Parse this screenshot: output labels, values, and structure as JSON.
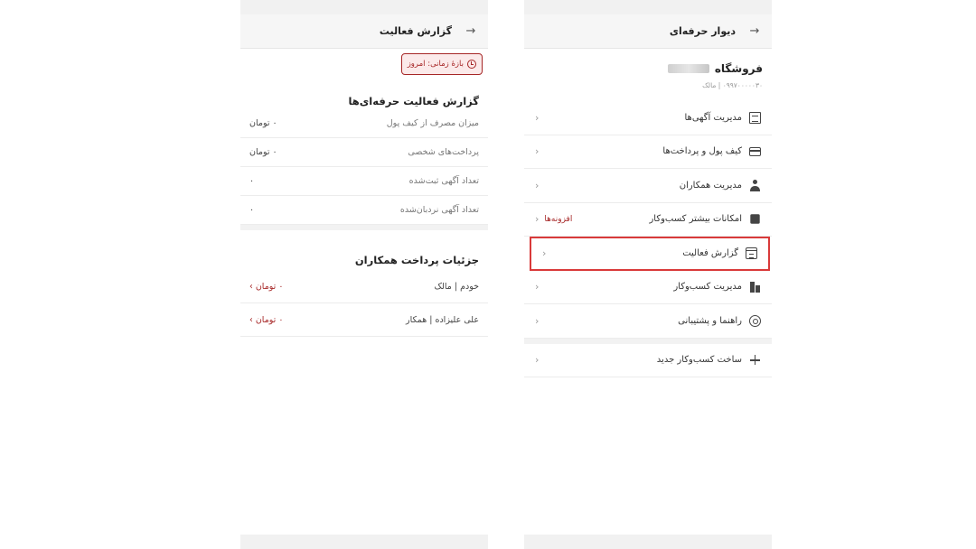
{
  "report": {
    "header": {
      "back_icon": "arrow-right-icon",
      "title": "گزارش فعالیت"
    },
    "period_chip": {
      "label": "بازهٔ زمانی: امروز",
      "color": "#a62626"
    },
    "pro_section": {
      "title": "گزارش فعالیت حرفه‌ای‌ها",
      "rows": [
        {
          "label": "میزان مصرف از کیف پول",
          "value": "۰ تومان"
        },
        {
          "label": "پرداخت‌های شخصی",
          "value": "۰ تومان"
        },
        {
          "label": "تعداد آگهی ثبت‌شده",
          "value": "۰"
        },
        {
          "label": "تعداد آگهی نردبان‌شده",
          "value": "۰"
        }
      ]
    },
    "colleague_section": {
      "title": "جزئیات پرداخت همکاران",
      "rows": [
        {
          "label": "خودم | مالک",
          "value": "۰ تومان ›"
        },
        {
          "label": "علی علیزاده | همکار",
          "value": "۰ تومان ›"
        }
      ]
    }
  },
  "menu": {
    "header": {
      "back_icon": "arrow-right-icon",
      "title": "دیوار حرفه‌ای"
    },
    "shop": {
      "name": "فروشگاه",
      "meta": "۰۹۹۷۰۰۰۰۰۳۰ | مالک"
    },
    "items": [
      {
        "label": "مدیریت آگهی‌ها",
        "icon": "document-icon",
        "chevron": "‹"
      },
      {
        "label": "کیف پول و پرداخت‌ها",
        "icon": "card-icon",
        "chevron": "‹"
      },
      {
        "label": "مدیریت همکاران",
        "icon": "user-icon",
        "chevron": "‹"
      },
      {
        "label": "امکانات بیشتر کسب‌وکار",
        "icon": "puzzle-icon",
        "badge": "افزونه‌ها",
        "chevron": "‹"
      },
      {
        "label": "گزارش فعالیت",
        "icon": "calendar-icon",
        "chevron": "‹",
        "highlight_color": "#d93a3a"
      },
      {
        "label": "مدیریت کسب‌وکار",
        "icon": "building-icon",
        "chevron": "‹"
      },
      {
        "label": "راهنما و پشتیبانی",
        "icon": "help-icon",
        "chevron": "‹"
      }
    ],
    "create_item": {
      "label": "ساخت کسب‌وکار جدید",
      "icon": "plus-icon",
      "chevron": "‹"
    }
  }
}
